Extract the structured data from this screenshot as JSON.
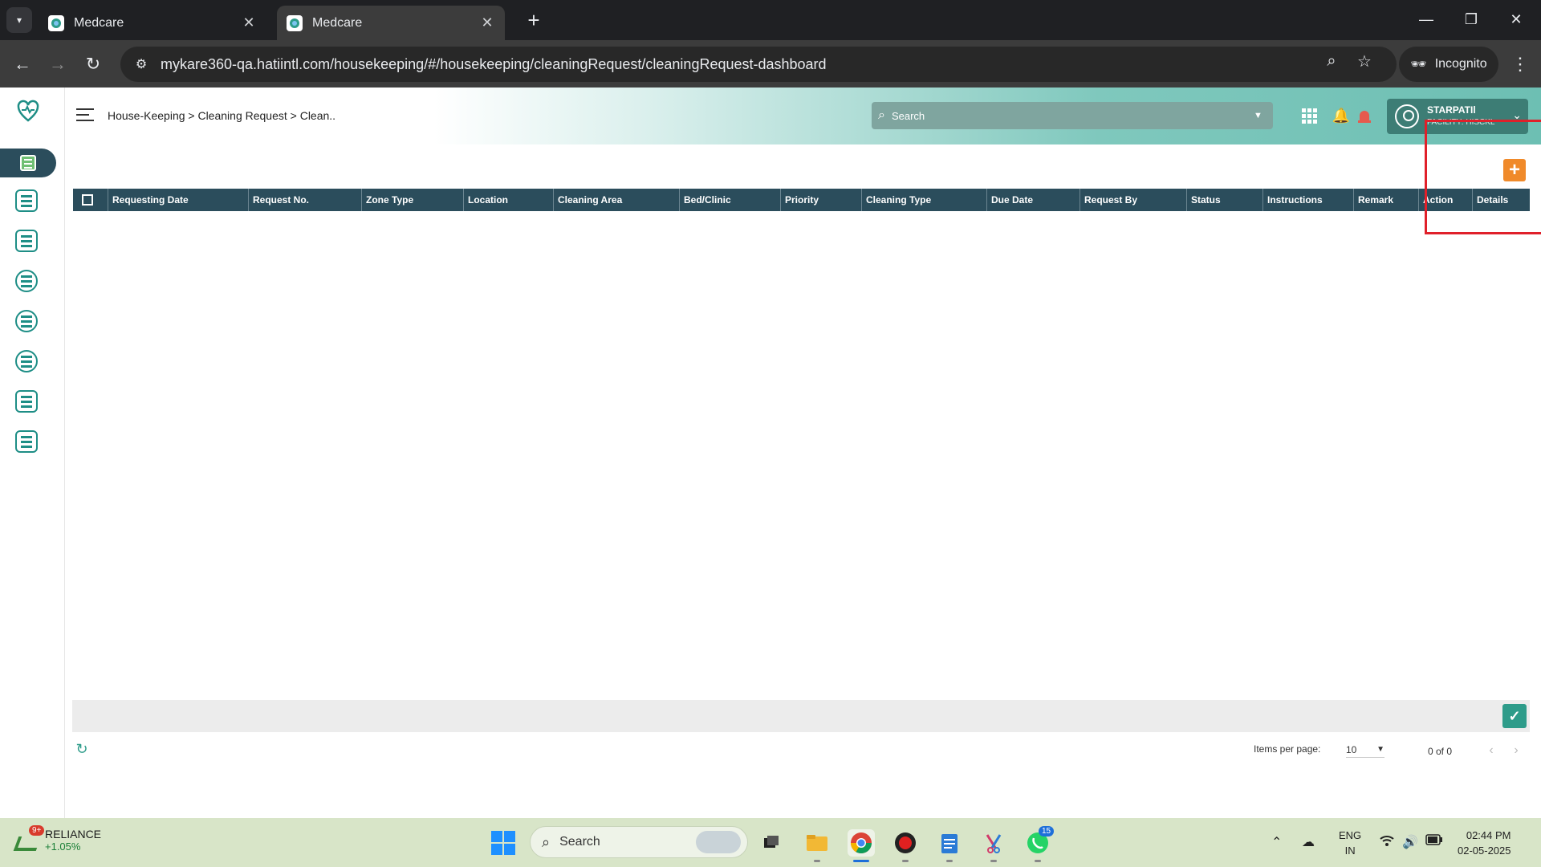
{
  "browser": {
    "tabs": [
      {
        "title": "Medcare",
        "close": "✕"
      },
      {
        "title": "Medcare",
        "close": "✕"
      }
    ],
    "new_tab": "+",
    "url": "mykare360-qa.hatiintl.com/housekeeping/#/housekeeping/cleaningRequest/cleaningRequest-dashboard",
    "incognito_label": "Incognito"
  },
  "header": {
    "breadcrumb": "House-Keeping > Cleaning Request > Clean..",
    "search_placeholder": "Search",
    "user_name": "STARPATIl",
    "facility": "FACILITY: HISCKL"
  },
  "sidebar": {
    "items": [
      {
        "icon": "cleaning-request-icon"
      },
      {
        "icon": "staff-icon"
      },
      {
        "icon": "schedule-icon"
      },
      {
        "icon": "inspection-icon"
      },
      {
        "icon": "laundry-icon"
      },
      {
        "icon": "checklist-icon"
      },
      {
        "icon": "reports-icon"
      },
      {
        "icon": "printer-icon"
      }
    ]
  },
  "table": {
    "columns": [
      "Requesting Date",
      "Request No.",
      "Zone Type",
      "Location",
      "Cleaning Area",
      "Bed/Clinic",
      "Priority",
      "Cleaning Type",
      "Due Date",
      "Request By",
      "Status",
      "Instructions",
      "Remark",
      "Action",
      "Details"
    ],
    "rows": []
  },
  "actions": {
    "add_label": "+",
    "confirm_label": "✓"
  },
  "pagination": {
    "items_per_page_label": "Items per page:",
    "items_per_page": "10",
    "range": "0 of 0"
  },
  "taskbar": {
    "stock_badge": "9+",
    "stock_name": "RELIANCE",
    "stock_change": "+1.05%",
    "search_label": "Search",
    "whatsapp_badge": "15",
    "lang_line1": "ENG",
    "lang_line2": "IN",
    "time": "02:44 PM",
    "date": "02-05-2025"
  },
  "colors": {
    "table_header": "#2b4d5c",
    "accent_teal": "#2e9c8a",
    "add_button": "#f08a2a",
    "highlight": "#e0202a"
  }
}
